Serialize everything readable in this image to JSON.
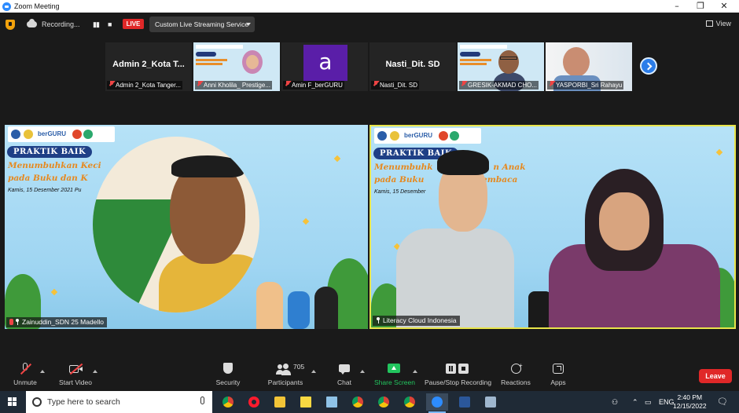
{
  "window": {
    "title": "Zoom Meeting"
  },
  "topbar": {
    "recording_label": "Recording...",
    "live_badge": "LIVE",
    "stream_dropdown": "Custom Live Streaming Service",
    "view_label": "View"
  },
  "thumbnails": [
    {
      "big_label": "Admin 2_Kota T...",
      "name": "Admin 2_Kota Tanger..."
    },
    {
      "name": "Anni Kholila_ Prestige..."
    },
    {
      "avatar_letter": "a",
      "name": "Amin F_berGURU"
    },
    {
      "big_label": "Nasti_Dit. SD",
      "name": "Nasti_Dit. SD"
    },
    {
      "name": "GRESIK-AKMAD CHO..."
    },
    {
      "name": "YASPORBI_Sri Rahayu"
    }
  ],
  "main_left": {
    "badge": "PRAKTIK BAIK",
    "headline_1": "Menumbuhkan Keci",
    "headline_2": "pada Buku dan K",
    "date": "Kamis, 15 Desember 2021 Pu",
    "logo_text": "berGURU",
    "name": "Zainuddin_SDN 25 Madello"
  },
  "main_right": {
    "badge": "PRAKTIK BAIK",
    "headline_1": "Menumbuhk                     n Anak",
    "headline_2": "pada Buku                 Membaca",
    "date": "Kamis, 15 Desember                          .00 WIB",
    "logo_text": "berGURU",
    "name": "Literacy Cloud Indonesia"
  },
  "toolbar": {
    "unmute": "Unmute",
    "start_video": "Start Video",
    "security": "Security",
    "participants": "Participants",
    "participants_count": "705",
    "chat": "Chat",
    "share_screen": "Share Screen",
    "pause_recording": "Pause/Stop Recording",
    "reactions": "Reactions",
    "apps": "Apps",
    "leave": "Leave"
  },
  "taskbar": {
    "search_placeholder": "Type here to search",
    "lang": "ENG",
    "time": "2:40 PM",
    "date": "12/15/2022"
  },
  "colors": {
    "accent_live": "#e02828",
    "zoom_blue": "#2d8cff",
    "active_speaker": "#e8e44a",
    "share_green": "#22c55e"
  }
}
